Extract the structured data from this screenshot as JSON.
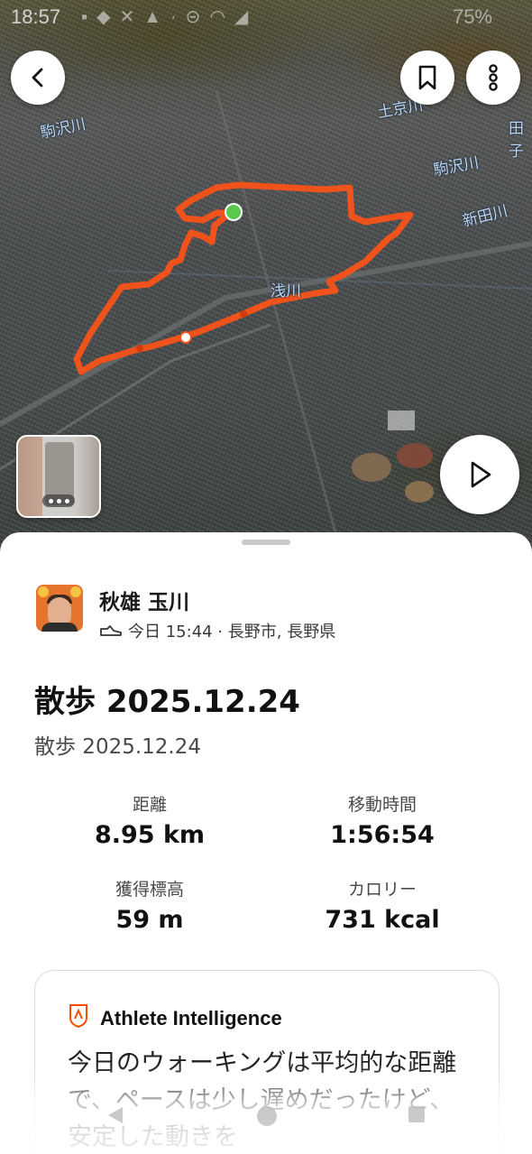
{
  "status_bar": {
    "time": "18:57",
    "battery": "75%"
  },
  "map": {
    "labels": [
      "駒沢川",
      "土京川",
      "駒沢川",
      "新田川",
      "浅川",
      "田子"
    ],
    "route_color": "#f0521b",
    "start_marker_color": "#5ac84a"
  },
  "header_buttons": {
    "back_icon": "chevron-left-icon",
    "bookmark_icon": "bookmark-icon",
    "more_icon": "more-vertical-icon",
    "play_icon": "play-icon"
  },
  "athlete": {
    "name": "秋雄 玉川",
    "meta": "今日 15:44 · 長野市, 長野県",
    "sport_icon": "shoe-icon"
  },
  "activity": {
    "title": "散歩 2025.12.24",
    "description": "散歩 2025.12.24"
  },
  "stats": [
    {
      "label": "距離",
      "value": "8.95 km"
    },
    {
      "label": "移動時間",
      "value": "1:56:54"
    },
    {
      "label": "獲得標高",
      "value": "59 m"
    },
    {
      "label": "カロリー",
      "value": "731 kcal"
    }
  ],
  "athlete_intelligence": {
    "title": "Athlete Intelligence",
    "text": "今日のウォーキングは平均的な距離で、ペースは少し遅めだったけど、安定した動きを"
  },
  "colors": {
    "accent": "#fc4c02"
  }
}
